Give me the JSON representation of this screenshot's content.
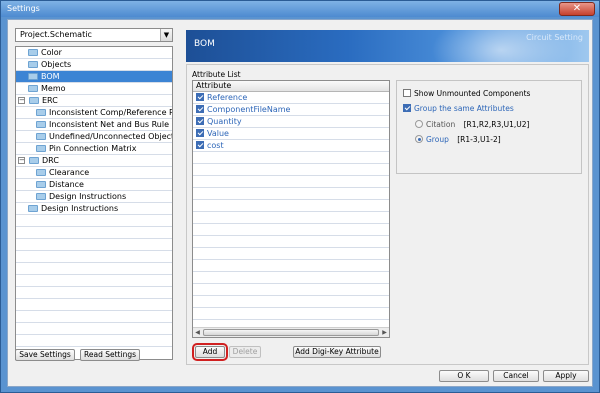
{
  "window": {
    "title": "Settings"
  },
  "left": {
    "project_combo": "Project.Schematic",
    "tree": [
      {
        "label": "Color",
        "level": 1,
        "selected": false,
        "expander": ""
      },
      {
        "label": "Objects",
        "level": 1,
        "selected": false,
        "expander": ""
      },
      {
        "label": "BOM",
        "level": 1,
        "selected": true,
        "expander": ""
      },
      {
        "label": "Memo",
        "level": 1,
        "selected": false,
        "expander": ""
      },
      {
        "label": "ERC",
        "level": 0,
        "selected": false,
        "expander": "−"
      },
      {
        "label": "Inconsistent Comp/Reference Rule",
        "level": 2,
        "selected": false,
        "expander": ""
      },
      {
        "label": "Inconsistent Net and Bus Rule",
        "level": 2,
        "selected": false,
        "expander": ""
      },
      {
        "label": "Undefined/Unconnected Objects",
        "level": 2,
        "selected": false,
        "expander": ""
      },
      {
        "label": "Pin Connection Matrix",
        "level": 2,
        "selected": false,
        "expander": ""
      },
      {
        "label": "DRC",
        "level": 0,
        "selected": false,
        "expander": "−"
      },
      {
        "label": "Clearance",
        "level": 2,
        "selected": false,
        "expander": ""
      },
      {
        "label": "Distance",
        "level": 2,
        "selected": false,
        "expander": ""
      },
      {
        "label": "Design Instructions",
        "level": 2,
        "selected": false,
        "expander": ""
      },
      {
        "label": "Design Instructions",
        "level": 1,
        "selected": false,
        "expander": ""
      }
    ],
    "empty_rows": 11,
    "save_settings": "Save Settings",
    "read_settings": "Read Settings"
  },
  "banner": {
    "title": "BOM",
    "subtitle": "Circuit Setting"
  },
  "attribute_list": {
    "label": "Attribute List",
    "header": "Attribute",
    "rows": [
      {
        "name": "Reference",
        "checked": true
      },
      {
        "name": "ComponentFileName",
        "checked": true
      },
      {
        "name": "Quantity",
        "checked": true
      },
      {
        "name": "Value",
        "checked": true
      },
      {
        "name": "cost",
        "checked": true
      }
    ],
    "empty_rows": 14
  },
  "options": {
    "show_unmounted": {
      "label": "Show Unmounted Components",
      "checked": false
    },
    "group_same": {
      "label": "Group the same Attributes",
      "checked": true
    },
    "citation": {
      "label": "Citation",
      "example": "[R1,R2,R3,U1,U2]",
      "selected": false
    },
    "group": {
      "label": "Group",
      "example": "[R1-3,U1-2]",
      "selected": true
    }
  },
  "buttons": {
    "add": "Add",
    "delete": "Delete",
    "add_digikey": "Add Digi-Key Attribute",
    "ok": "O K",
    "cancel": "Cancel",
    "apply": "Apply"
  },
  "colors": {
    "accent": "#3c84d4",
    "link": "#2d66b8",
    "highlight": "#d02020"
  }
}
